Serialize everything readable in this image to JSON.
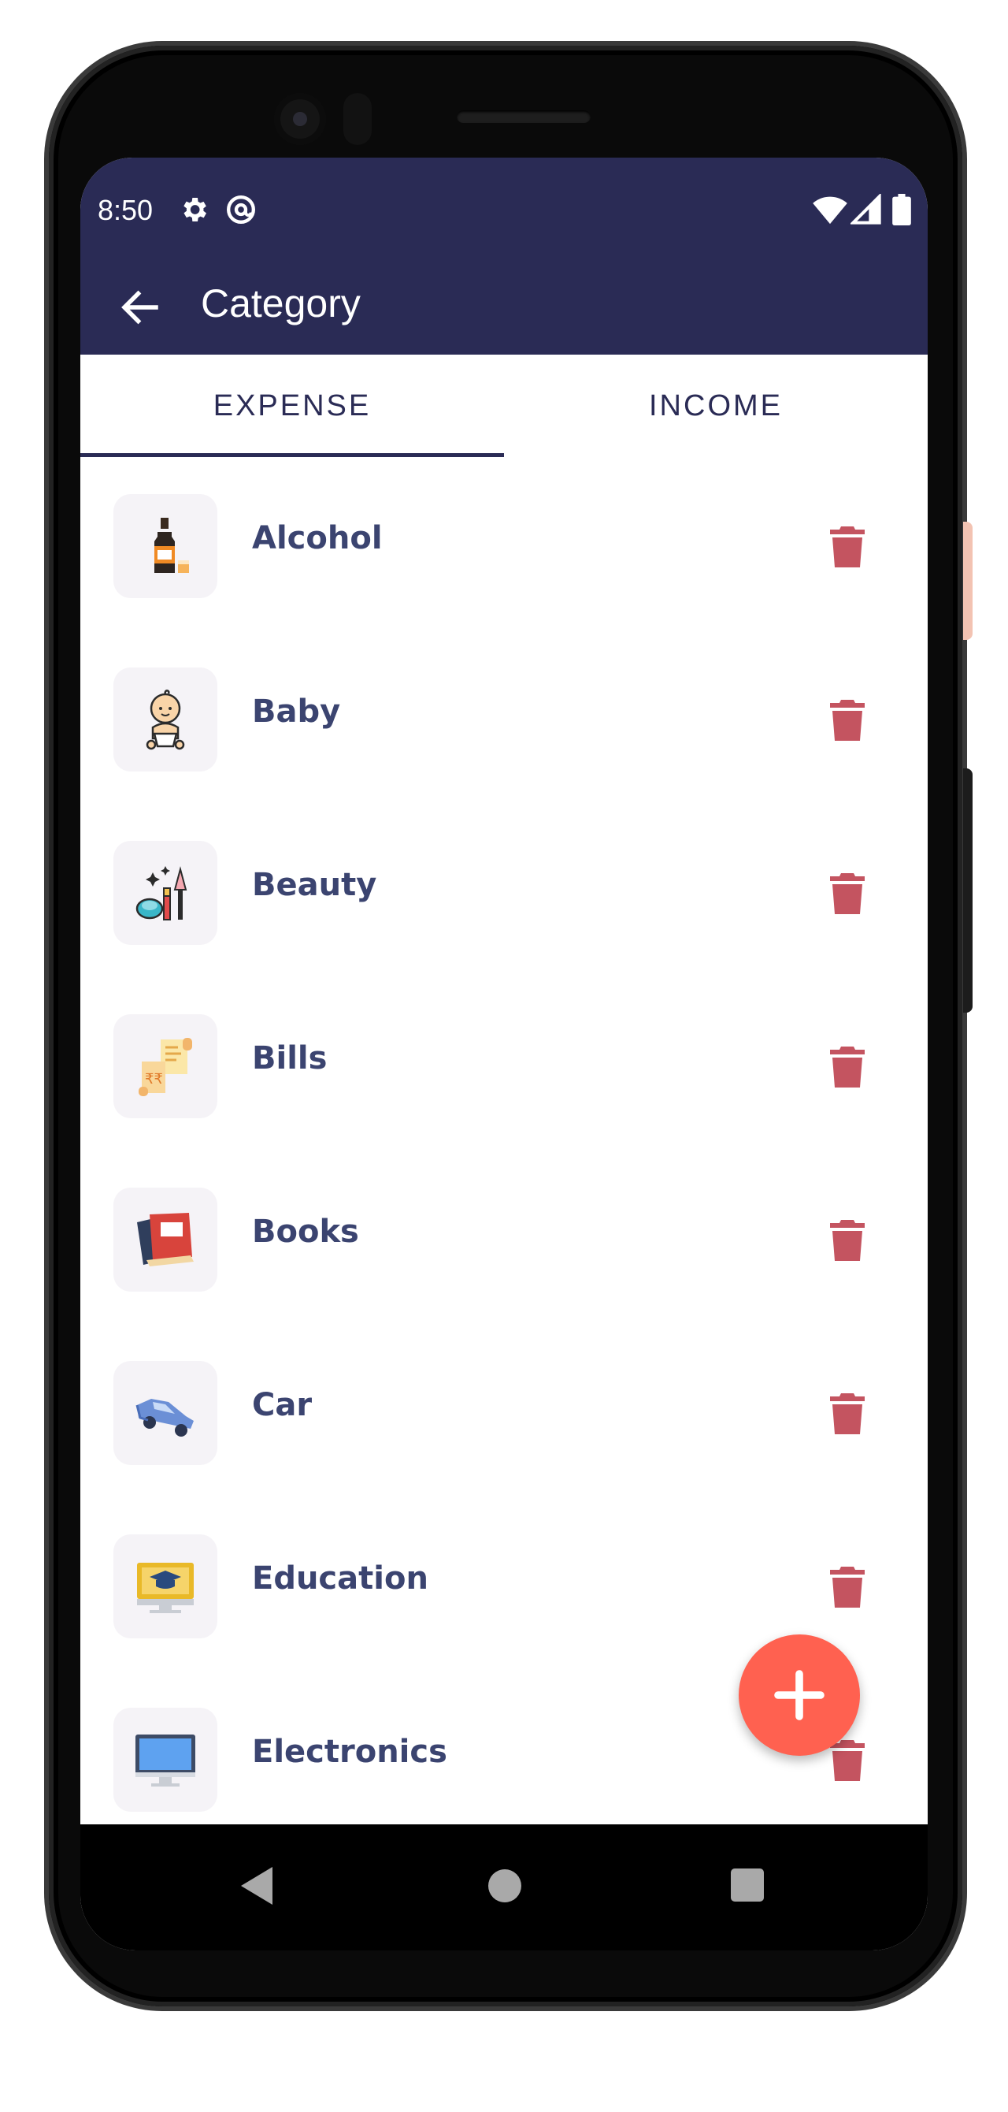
{
  "status_bar": {
    "time": "8:50",
    "icons": [
      "settings-gear-icon",
      "at-sign-icon",
      "wifi-icon",
      "cell-signal-icon",
      "battery-icon"
    ]
  },
  "app_bar": {
    "title": "Category",
    "back_icon": "arrow-left-icon",
    "background": "#2a2b55"
  },
  "tabs": [
    {
      "label": "EXPENSE",
      "selected": true
    },
    {
      "label": "INCOME",
      "selected": false
    }
  ],
  "categories": [
    {
      "name": "Alcohol",
      "icon": "bottle-icon"
    },
    {
      "name": "Baby",
      "icon": "baby-icon"
    },
    {
      "name": "Beauty",
      "icon": "makeup-icon"
    },
    {
      "name": "Bills",
      "icon": "receipt-icon"
    },
    {
      "name": "Books",
      "icon": "book-icon"
    },
    {
      "name": "Car",
      "icon": "car-icon"
    },
    {
      "name": "Education",
      "icon": "graduation-laptop-icon"
    },
    {
      "name": "Electronics",
      "icon": "monitor-icon"
    }
  ],
  "actions": {
    "delete_icon": "trash-icon",
    "delete_color": "#c45460",
    "fab_icon": "plus-icon",
    "fab_color": "#ff6150"
  },
  "nav_bar": {
    "icons": [
      "nav-back-icon",
      "nav-home-icon",
      "nav-recents-icon"
    ]
  }
}
